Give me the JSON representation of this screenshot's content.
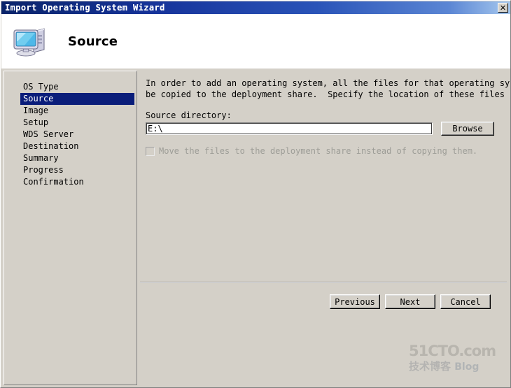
{
  "window": {
    "title": "Import Operating System Wizard",
    "close_icon": "close-icon",
    "close_glyph": "✕"
  },
  "header": {
    "icon": "computer-icon",
    "title": "Source"
  },
  "sidebar": {
    "items": [
      {
        "label": "OS Type",
        "selected": false
      },
      {
        "label": "Source",
        "selected": true
      },
      {
        "label": "Image",
        "selected": false
      },
      {
        "label": "Setup",
        "selected": false
      },
      {
        "label": "WDS Server",
        "selected": false
      },
      {
        "label": "Destination",
        "selected": false
      },
      {
        "label": "Summary",
        "selected": false
      },
      {
        "label": "Progress",
        "selected": false
      },
      {
        "label": "Confirmation",
        "selected": false
      }
    ]
  },
  "content": {
    "description": "In order to add an operating system, all the files for that operating system need to\nbe copied to the deployment share.  Specify the location of these files (typically a",
    "field_label": "Source directory:",
    "source_directory_value": "E:\\",
    "source_directory_placeholder": "",
    "browse_label": "Browse",
    "move_checkbox_label": "Move the files to the deployment share instead of copying them.",
    "move_checkbox_checked": false,
    "move_checkbox_disabled": true
  },
  "footer": {
    "previous_label": "Previous",
    "next_label": "Next",
    "cancel_label": "Cancel"
  },
  "watermark": {
    "line1": "51CTO.com",
    "line2": "技术博客",
    "blog": "Blog"
  },
  "colors": {
    "titlebar_start": "#0a246a",
    "titlebar_end": "#a6c8ee",
    "dialog_face": "#d4d0c8",
    "selection": "#0a1d7a",
    "header_background": "#ffffff",
    "disabled_text": "#9d9d97"
  }
}
